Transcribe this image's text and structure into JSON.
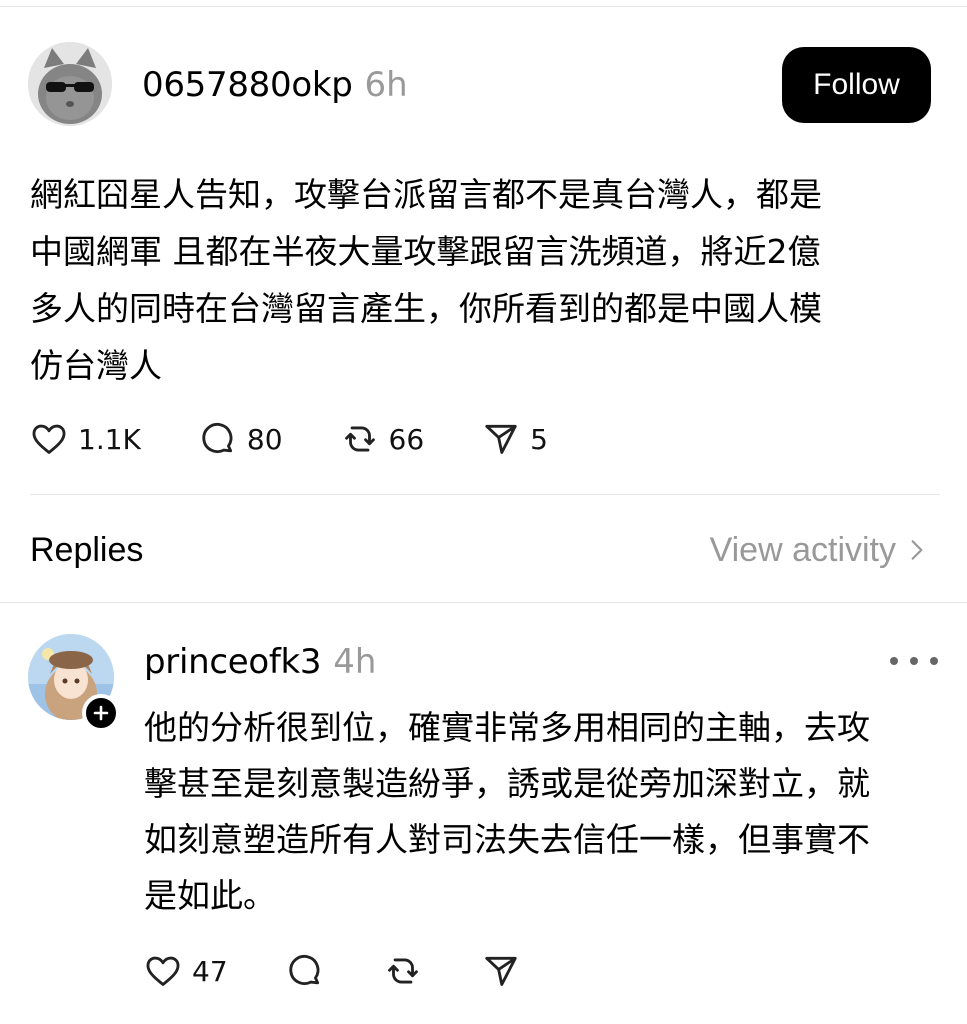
{
  "post": {
    "username": "0657880okp",
    "time": "6h",
    "follow_label": "Follow",
    "body": "網紅囧星人告知，攻擊台派留言都不是真台灣人，都是\n中國網軍 且都在半夜大量攻擊跟留言洗頻道，將近2億\n多人的同時在台灣留言產生，你所看到的都是中國人模\n仿台灣人",
    "likes": "1.1K",
    "comments": "80",
    "reposts": "66",
    "shares": "5"
  },
  "replies_section": {
    "title": "Replies",
    "view_activity": "View activity"
  },
  "reply": {
    "username": "princeofk3",
    "time": "4h",
    "body": "他的分析很到位，確實非常多用相同的主軸，去攻\n擊甚至是刻意製造紛爭，誘或是從旁加深對立，就\n如刻意塑造所有人對司法失去信任一樣，但事實不\n是如此。",
    "likes": "47"
  },
  "icons": {
    "like": "heart-icon",
    "comment": "comment-bubble-icon",
    "repost": "repost-icon",
    "share": "send-icon",
    "chevron": "chevron-right-icon",
    "more": "more-dots-icon",
    "plus": "plus-icon"
  }
}
